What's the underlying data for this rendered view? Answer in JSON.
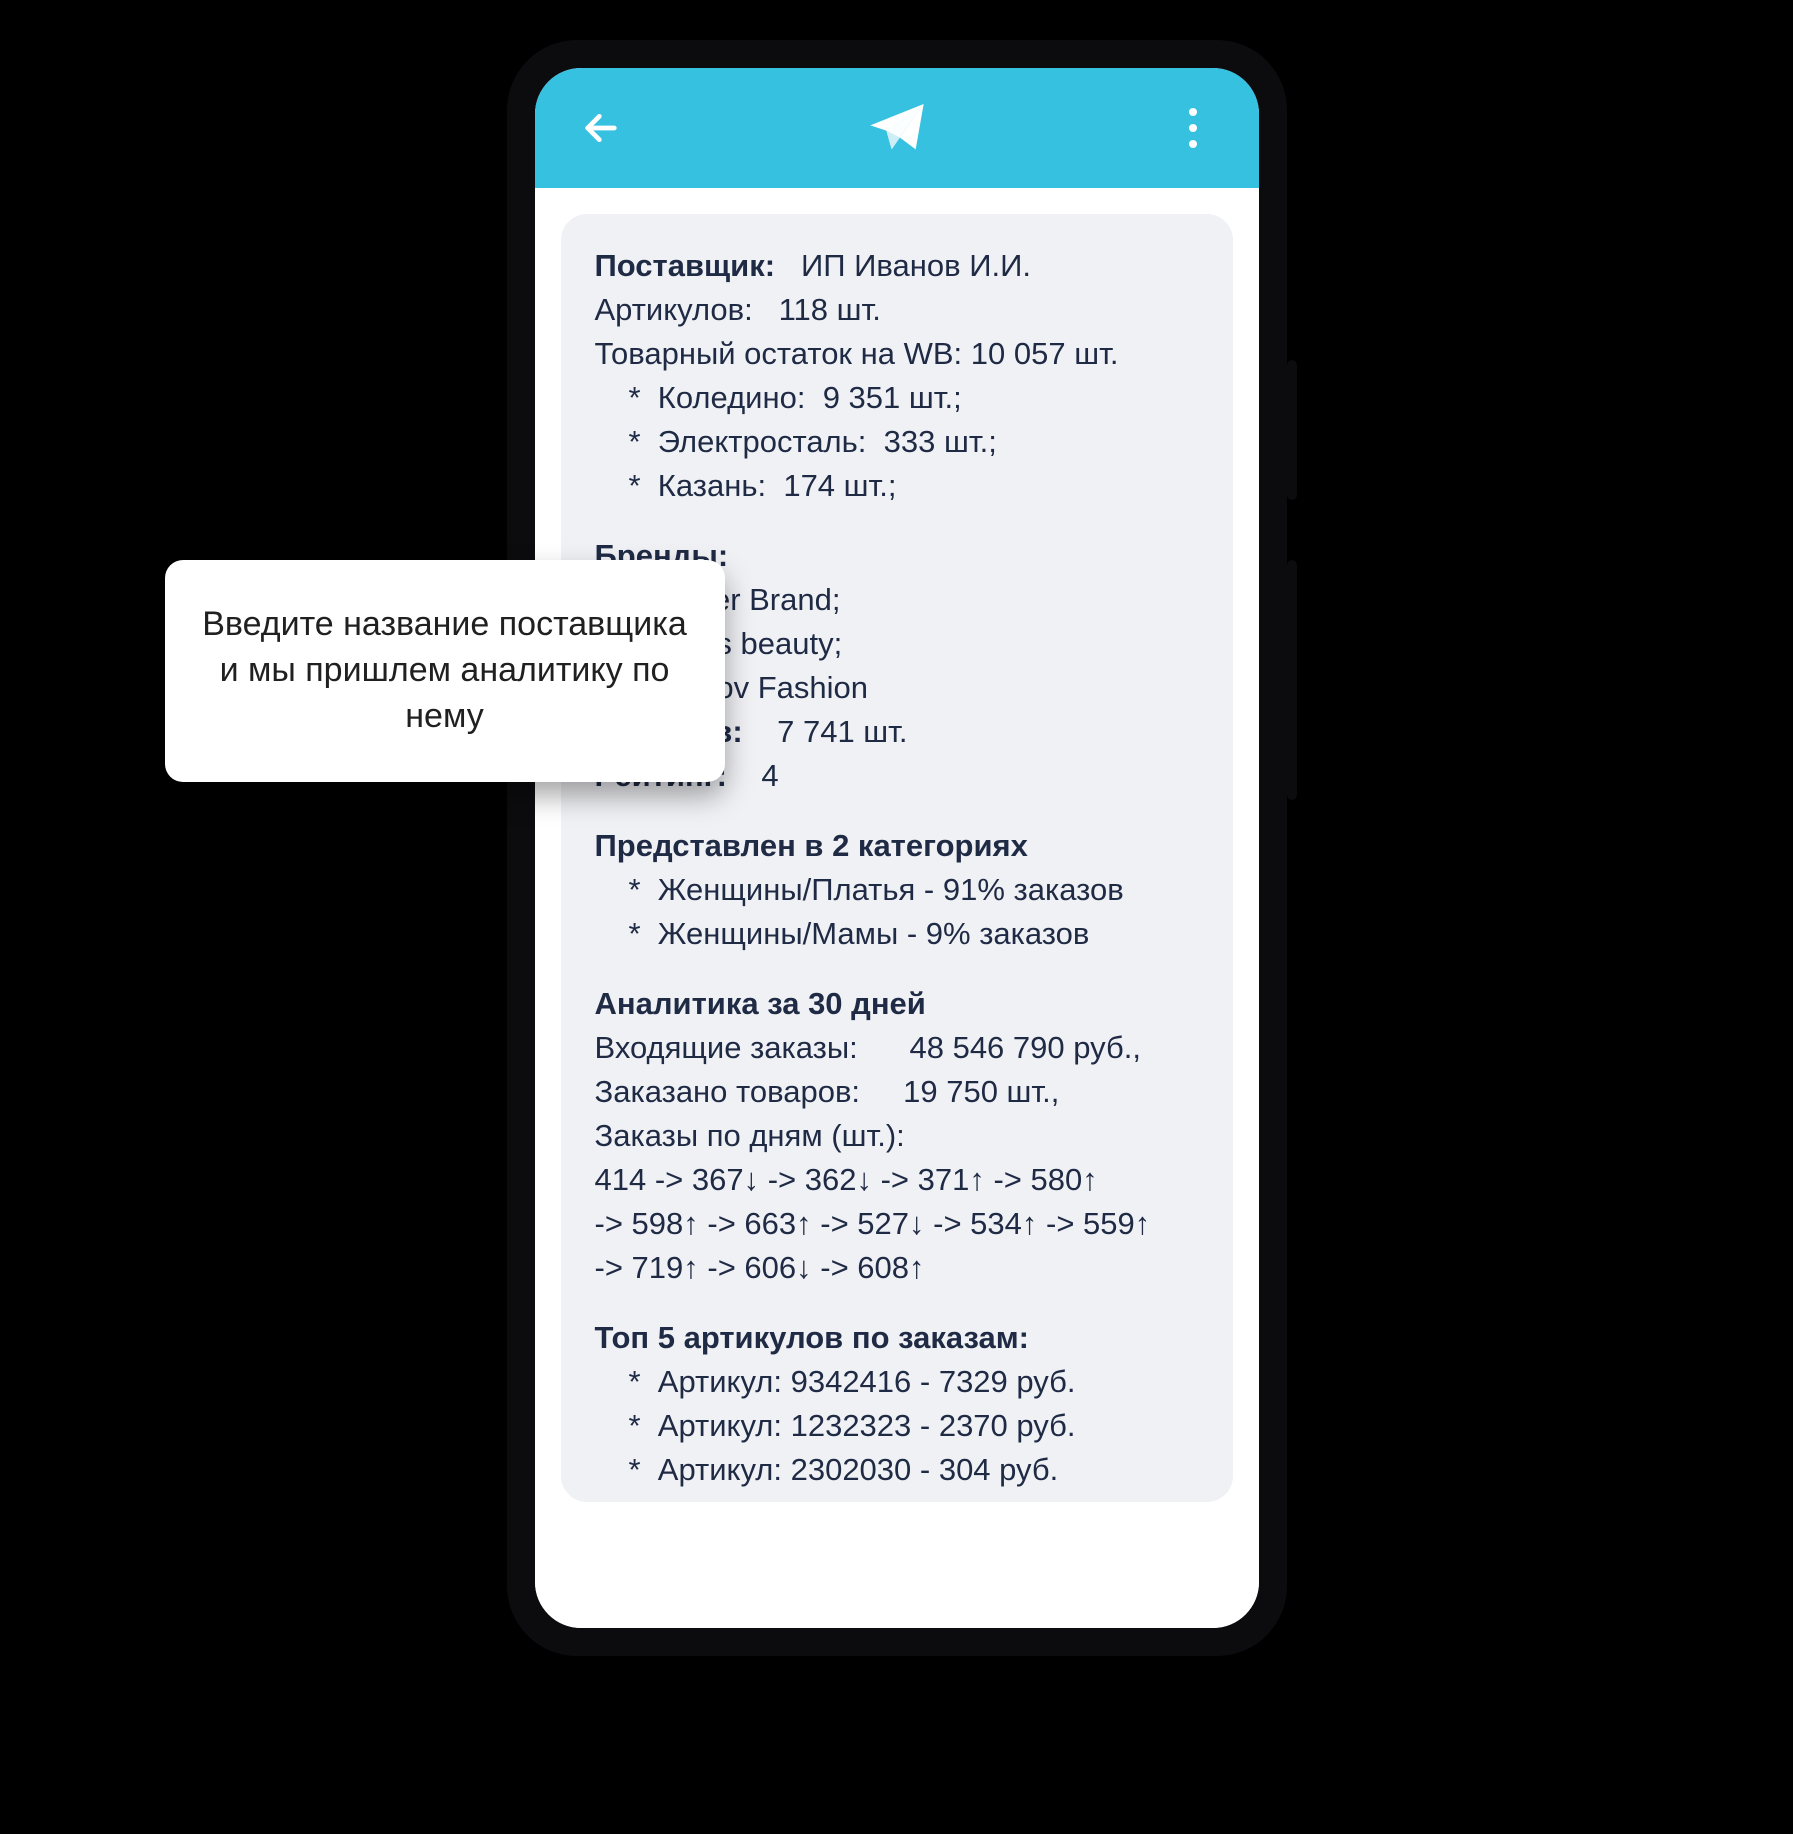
{
  "tooltip_text": "Введите название поставщика и мы пришлем аналитику по нему",
  "supplier": {
    "label": "Поставщик:",
    "name": "ИП Иванов И.И.",
    "articles_label": "Артикулов:",
    "articles_value": "118 шт.",
    "stock_label": "Товарный остаток на WB:",
    "stock_value": "10 057 шт.",
    "warehouses": [
      {
        "name": "Коледино:",
        "value": "9 351 шт.;"
      },
      {
        "name": "Электросталь:",
        "value": "333 шт.;"
      },
      {
        "name": "Казань:",
        "value": "174 шт.;"
      }
    ]
  },
  "brands": {
    "heading": "Бренды:",
    "items": [
      "Super Brand;",
      "Ivans beauty;",
      "Ivanov Fashion"
    ],
    "reviews_label": "Отзывов:",
    "reviews_value": "7 741 шт.",
    "rating_label": "Рейтинг:",
    "rating_value": "4"
  },
  "categories": {
    "heading": "Представлен в 2 категориях",
    "items": [
      "Женщины/Платья  - 91% заказов",
      "Женщины/Мамы - 9% заказов"
    ]
  },
  "analytics": {
    "heading": "Аналитика за 30 дней",
    "incoming_label": "Входящие заказы:",
    "incoming_value": "48 546 790 руб.,",
    "ordered_label": "Заказано товаров:",
    "ordered_value": "19 750 шт.,",
    "daily_label": "Заказы по дням (шт.):",
    "daily_lines": [
      "414 -> 367↓ -> 362↓ -> 371↑ -> 580↑",
      " -> 598↑ -> 663↑ -> 527↓ -> 534↑ -> 559↑",
      " -> 719↑ -> 606↓ -> 608↑"
    ]
  },
  "top": {
    "heading": "Топ 5 артикулов по заказам:",
    "items": [
      "Артикул: 9342416 - 7329 руб.",
      "Артикул: 1232323 - 2370 руб.",
      "Артикул: 2302030  - 304 руб."
    ]
  }
}
